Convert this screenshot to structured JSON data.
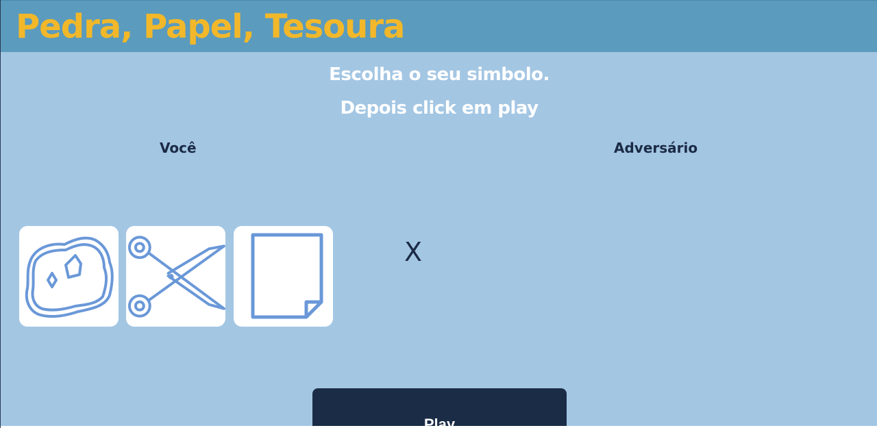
{
  "header": {
    "title": "Pedra, Papel, Tesoura"
  },
  "instructions": {
    "line1": "Escolha o seu simbolo.",
    "line2": "Depois click em play"
  },
  "players": {
    "you": "Você",
    "opponent": "Adversário"
  },
  "choices": [
    {
      "name": "pedra",
      "icon": "rock-icon"
    },
    {
      "name": "tesoura",
      "icon": "scissors-icon"
    },
    {
      "name": "papel",
      "icon": "paper-icon"
    }
  ],
  "versus": "X",
  "play_label": "Play",
  "colors": {
    "background": "#a3c6e3",
    "header": "#5b9bbd",
    "title": "#f2b82a",
    "icon_stroke": "#6a98d8",
    "dark": "#1b2c46"
  }
}
